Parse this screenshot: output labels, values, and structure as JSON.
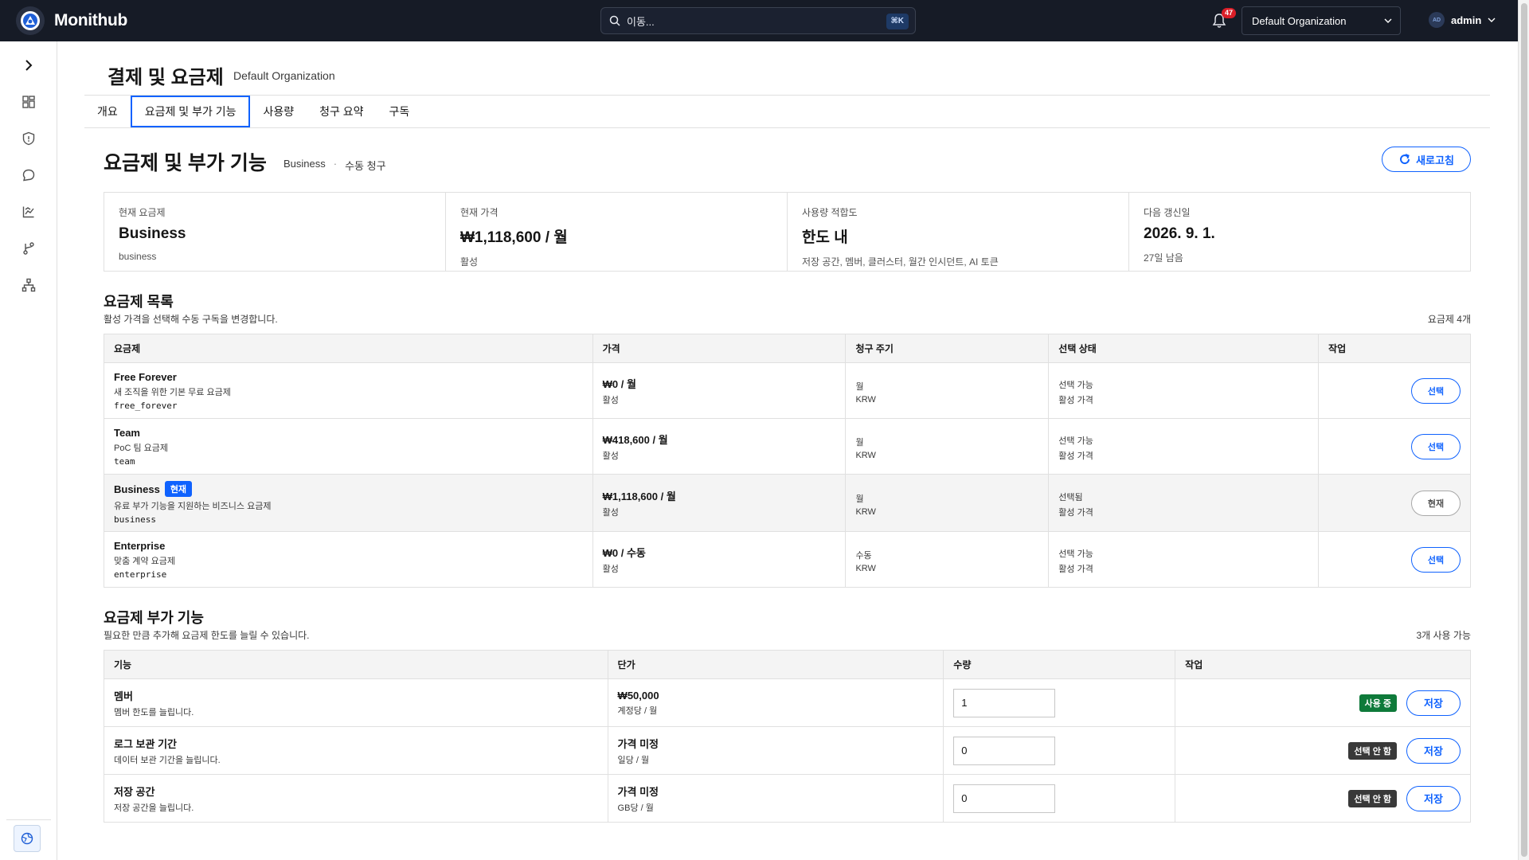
{
  "app": {
    "brand": "Monithub",
    "search_placeholder": "이동...",
    "search_shortcut": "⌘K",
    "notifications_count": "47",
    "org": "Default Organization",
    "user_initials": "AD",
    "user": "admin"
  },
  "page": {
    "title": "결제 및 요금제",
    "subtitle": "Default Organization"
  },
  "tabs": [
    "개요",
    "요금제 및 부가 기능",
    "사용량",
    "청구 요약",
    "구독"
  ],
  "section": {
    "title": "요금제 및 부가 기능",
    "meta_plan": "Business",
    "meta_billing": "수동 청구",
    "refresh_label": "새로고침"
  },
  "summary": [
    {
      "label": "현재 요금제",
      "value": "Business",
      "note": "business"
    },
    {
      "label": "현재 가격",
      "value": "₩1,118,600 / 월",
      "note": "활성"
    },
    {
      "label": "사용량 적합도",
      "value": "한도 내",
      "note": "저장 공간, 멤버, 클러스터, 월간 인시던트, AI 토큰"
    },
    {
      "label": "다음 갱신일",
      "value": "2026. 9. 1.",
      "note": "27일 남음"
    }
  ],
  "plans": {
    "title": "요금제 목록",
    "desc": "활성 가격을 선택해 수동 구독을 변경합니다.",
    "count": "요금제 4개",
    "columns": [
      "요금제",
      "가격",
      "청구 주기",
      "선택 상태",
      "작업"
    ],
    "current_tag": "현재",
    "rows": [
      {
        "name": "Free Forever",
        "desc": "새 조직을 위한 기본 무료 요금제",
        "code": "free_forever",
        "price": "₩0 / 월",
        "price_status": "활성",
        "cycle": "월",
        "currency": "KRW",
        "select_state": "선택 가능",
        "price_state": "활성 가격",
        "action": "선택"
      },
      {
        "name": "Team",
        "desc": "PoC 팀 요금제",
        "code": "team",
        "price": "₩418,600 / 월",
        "price_status": "활성",
        "cycle": "월",
        "currency": "KRW",
        "select_state": "선택 가능",
        "price_state": "활성 가격",
        "action": "선택"
      },
      {
        "name": "Business",
        "desc": "유료 부가 기능을 지원하는 비즈니스 요금제",
        "code": "business",
        "price": "₩1,118,600 / 월",
        "price_status": "활성",
        "cycle": "월",
        "currency": "KRW",
        "select_state": "선택됨",
        "price_state": "활성 가격",
        "action": "현재"
      },
      {
        "name": "Enterprise",
        "desc": "맞춤 계약 요금제",
        "code": "enterprise",
        "price": "₩0 / 수동",
        "price_status": "활성",
        "cycle": "수동",
        "currency": "KRW",
        "select_state": "선택 가능",
        "price_state": "활성 가격",
        "action": "선택"
      }
    ]
  },
  "addons": {
    "title": "요금제 부가 기능",
    "desc": "필요한 만큼 추가해 요금제 한도를 늘릴 수 있습니다.",
    "count": "3개 사용 가능",
    "columns": [
      "기능",
      "단가",
      "수량",
      "작업"
    ],
    "rows": [
      {
        "name": "멤버",
        "desc": "멤버 한도를 늘립니다.",
        "price": "₩50,000",
        "unit": "계정당 / 월",
        "qty": "1",
        "status": "사용 중",
        "status_color": "#0e7a3a",
        "action": "저장"
      },
      {
        "name": "로그 보관 기간",
        "desc": "데이터 보관 기간을 늘립니다.",
        "price": "가격 미정",
        "unit": "일당 / 월",
        "qty": "0",
        "status": "선택 안 함",
        "status_color": "#393939",
        "action": "저장"
      },
      {
        "name": "저장 공간",
        "desc": "저장 공간을 늘립니다.",
        "price": "가격 미정",
        "unit": "GB당 / 월",
        "qty": "0",
        "status": "선택 안 함",
        "status_color": "#393939",
        "action": "저장"
      }
    ]
  },
  "colors": {
    "accent": "#0f62fe",
    "topbar": "#161b26",
    "badge_red": "#da1e28"
  }
}
